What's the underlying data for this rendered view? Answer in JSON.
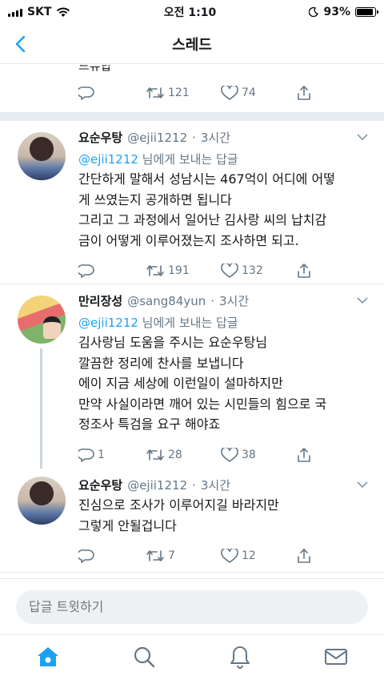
{
  "status_bar": {
    "carrier": "SKT",
    "time": "오전 1:10",
    "battery": "93%",
    "battery_level": 0.93
  },
  "header": {
    "title": "스레드"
  },
  "top_partial": {
    "cutoff_text": "드뷰합",
    "retweets": "121",
    "likes": "74"
  },
  "tweets": [
    {
      "name": "요순우탕",
      "handle": "@ejii1212",
      "time": "3시간",
      "reply_mention": "@ejii1212",
      "reply_suffix": " 님에게 보내는 답글",
      "text": "간단하게 말해서 성남시는 467억이 어디에 어떻\n게 쓰였는지 공개하면 됩니다\n그리고 그 과정에서 일어난 김사랑 씨의 납치감\n금이 어떻게 이루어졌는지 조사하면 되고.",
      "replies": "",
      "retweets": "191",
      "likes": "132"
    },
    {
      "name": "만리장성",
      "handle": "@sang84yun",
      "time": "3시간",
      "reply_mention": "@ejii1212",
      "reply_suffix": " 님에게 보내는 답글",
      "text": "김사랑님 도움을  주시는 요순우탕님\n깔끔한 정리에 찬사를 보냅니다\n에이 지금 세상에 이런일이 설마하지만\n만약 사실이라면 깨어 있는 시민들의 힘으로 국\n정조사 특검을 요구 해야죠",
      "replies": "1",
      "retweets": "28",
      "likes": "38"
    },
    {
      "name": "요순우탕",
      "handle": "@ejii1212",
      "time": "3시간",
      "text": "진심으로 조사가 이루어지길 바라지만\n그렇게 안될겁니다",
      "replies": "",
      "retweets": "7",
      "likes": "12"
    }
  ],
  "compose": {
    "placeholder": "답글 트윗하기"
  },
  "tabs": [
    "home-icon",
    "search-icon",
    "notifications-icon",
    "messages-icon"
  ],
  "colors": {
    "accent": "#1da1f2",
    "text_secondary": "#657786",
    "divider": "#e1e8ed"
  }
}
